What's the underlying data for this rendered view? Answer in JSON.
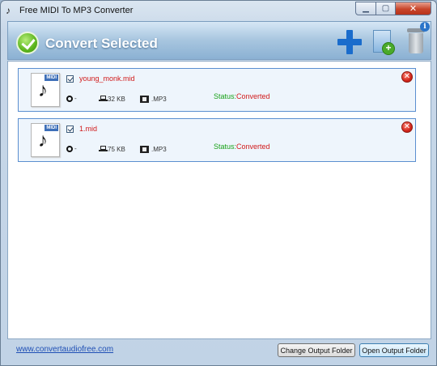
{
  "window": {
    "title": "Free MIDI To MP3 Converter"
  },
  "toolbar": {
    "convert_label": "Convert Selected"
  },
  "files": [
    {
      "name": "young_monk.mid",
      "duration": "-",
      "size": "32 KB",
      "format": ".MP3",
      "status_label": "Status:",
      "status_value": "Converted",
      "checked": true
    },
    {
      "name": "1.mid",
      "duration": "-",
      "size": "75 KB",
      "format": ".MP3",
      "status_label": "Status:",
      "status_value": "Converted",
      "checked": true
    }
  ],
  "footer": {
    "link": "www.convertaudiofree.com",
    "change_folder": "Change Output Folder",
    "open_folder": "Open Output Folder"
  },
  "colors": {
    "accent": "#1a6ccc",
    "status_ok": "#19a219",
    "filename": "#d11a1a"
  }
}
